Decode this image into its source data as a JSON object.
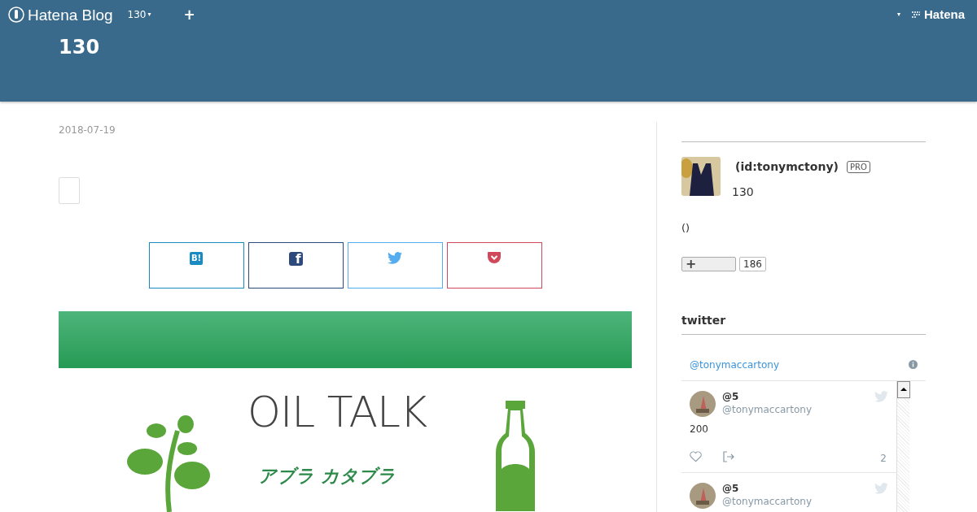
{
  "header": {
    "logo": "Hatena Blog",
    "blog_menu": "130",
    "blog_menu_caret": "▾",
    "add": "+",
    "user_caret": "▾",
    "brand": "Hatena",
    "blog_title": "130"
  },
  "entry": {
    "date": "2018-07-19",
    "share_buttons": [
      {
        "kind": "hatena",
        "label": "B!",
        "color": "#1a8ac2"
      },
      {
        "kind": "facebook",
        "label": "f",
        "color": "#2e4a7d"
      },
      {
        "kind": "twitter",
        "color": "#55acee"
      },
      {
        "kind": "pocket",
        "color": "#d0485a"
      }
    ],
    "banner": {
      "title": "OIL TALK",
      "subtitle": "アブラ カタブラ"
    }
  },
  "sidebar": {
    "profile": {
      "name": "(id:tonymctony)",
      "badge": "PRO",
      "blog": "130",
      "note": "()",
      "subscribe": "+",
      "subscribers": "186"
    },
    "twitter": {
      "heading": "twitter",
      "account": "@tonymaccartony",
      "tweets": [
        {
          "name": "@5",
          "handle": "@tonymaccartony",
          "text": "200",
          "count": "2"
        },
        {
          "name": "@5",
          "handle": "@tonymaccartony"
        }
      ]
    }
  }
}
